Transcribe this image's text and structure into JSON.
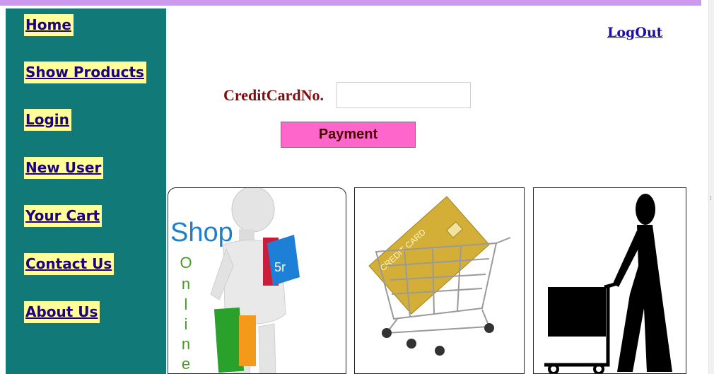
{
  "nav": {
    "home": "Home",
    "show_products": "Show Products",
    "login": "Login",
    "new_user": "New User",
    "your_cart": "Your Cart",
    "contact_us": "Contact Us",
    "about_us": "About Us"
  },
  "header": {
    "logout": "LogOut"
  },
  "payment_form": {
    "credit_card_label": "CreditCardNo.",
    "credit_card_value": "",
    "pay_button": "Payment"
  },
  "images": {
    "shop_online": {
      "word": "Shop",
      "letters": [
        "O",
        "n",
        "l",
        "i",
        "n",
        "e"
      ],
      "bag_text": "5r"
    },
    "credit_card_cart": {
      "card_text": "CREDIT CARD"
    },
    "shopper_cart": {}
  },
  "colors": {
    "top_bar": "#cc99ee",
    "sidebar": "#117a78",
    "nav_highlight": "#ffff99",
    "nav_text": "#1f0080",
    "label_text": "#7a1010",
    "pay_button": "#ff66cc",
    "link": "#1a0dab"
  }
}
